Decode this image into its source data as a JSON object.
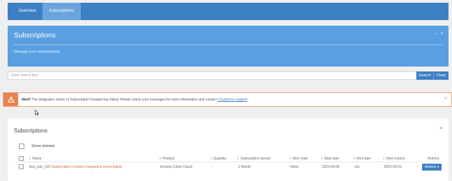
{
  "nav": {
    "tabs": [
      {
        "label": "Overview"
      },
      {
        "label": "Subscriptions"
      }
    ]
  },
  "hero": {
    "title": "Subscriptions",
    "description": "Manage your subscriptions.",
    "minimize": "–",
    "close": "×"
  },
  "search": {
    "placeholder": "Enter search text",
    "search_label": "Search",
    "clear_label": "Clear"
  },
  "alert": {
    "strong": "Alert!",
    "message": " The integration action of Subscription Created has failed. Please check your messages for more information and contact ",
    "link": "Cloudmore support",
    "tail": ".",
    "close": "×",
    "icon": "warning-icon"
  },
  "panel": {
    "title": "Subscriptions",
    "menu_icon": "≡",
    "show_deleted_label": "Show deleted"
  },
  "table": {
    "columns": [
      "Name",
      "Product",
      "Quantity",
      "Subscription period",
      "Item code",
      "Start date",
      "End date",
      "Next invoice",
      "Actions"
    ],
    "rows": [
      {
        "name": "test_sub_123",
        "error": "(Subscription creation integration event failed)",
        "product": "Acronis Cyber Cloud",
        "quantity": "-",
        "period": "1 Month",
        "item_code": "None",
        "start_date": "2023-04-05",
        "end_date": "n/a",
        "next_invoice": "2023-05-01",
        "action_label": "Actions ▾"
      }
    ]
  }
}
